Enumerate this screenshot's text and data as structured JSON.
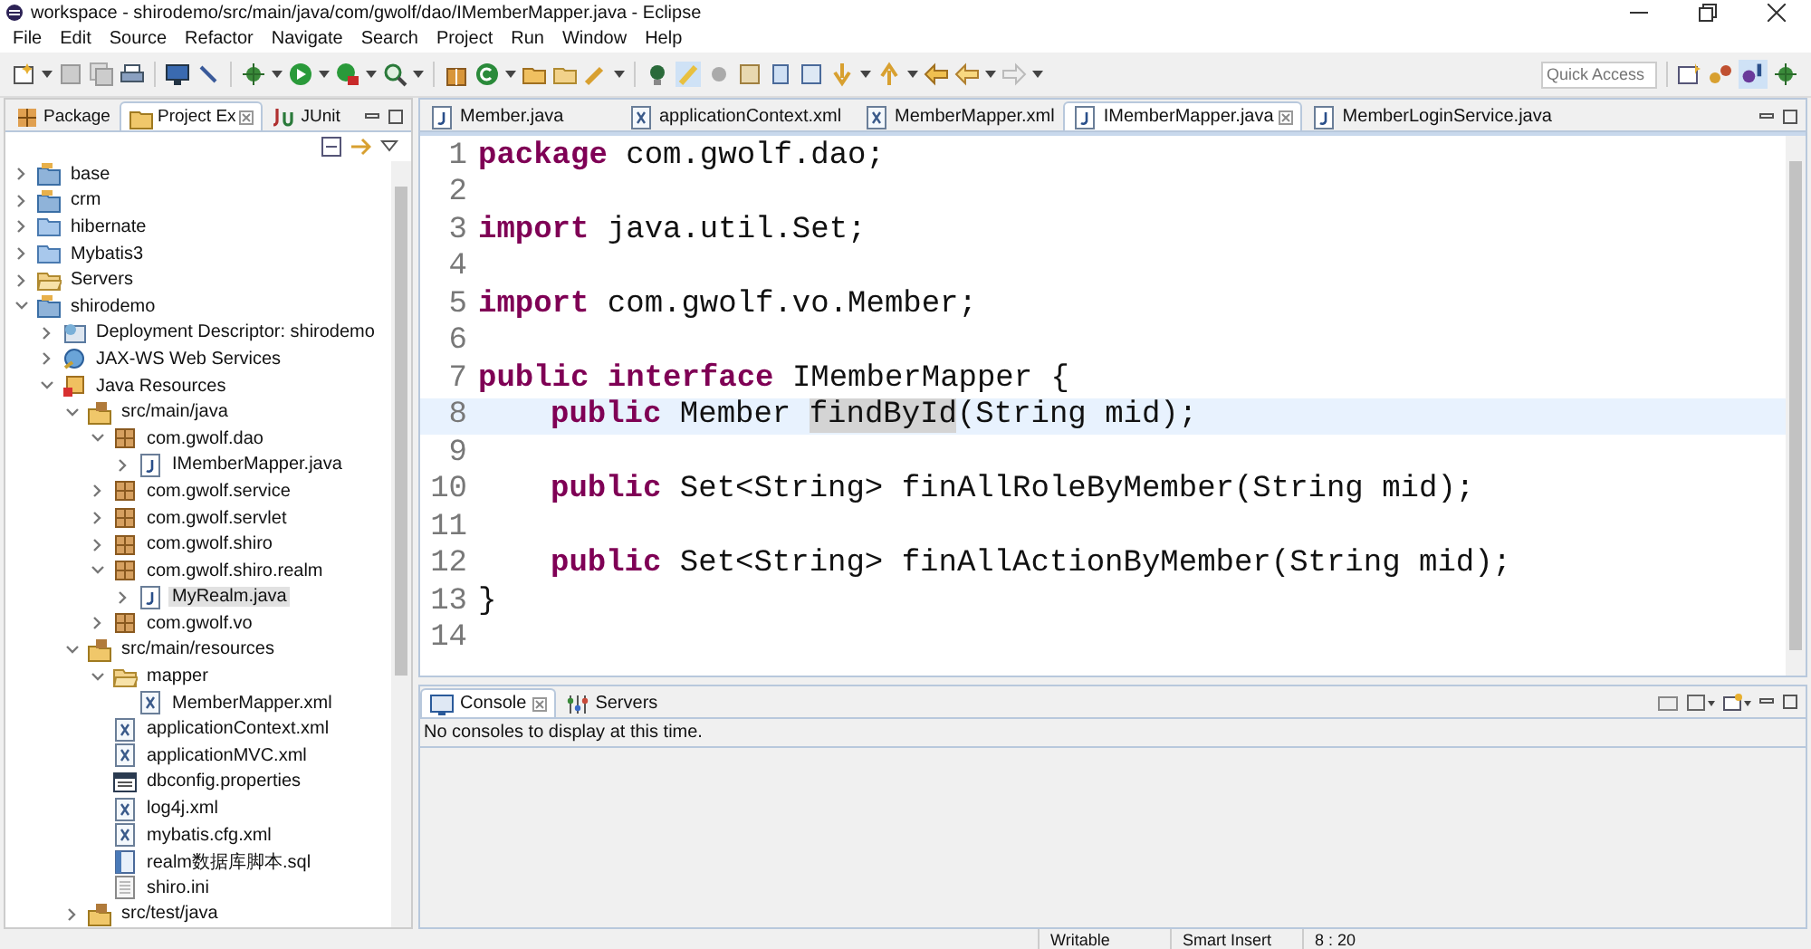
{
  "window": {
    "title": "workspace - shirodemo/src/main/java/com/gwolf/dao/IMemberMapper.java - Eclipse"
  },
  "menu": [
    "File",
    "Edit",
    "Source",
    "Refactor",
    "Navigate",
    "Search",
    "Project",
    "Run",
    "Window",
    "Help"
  ],
  "quick_access": {
    "placeholder": "Quick Access"
  },
  "left_panel": {
    "tabs": [
      {
        "label": "Package",
        "selected": false,
        "kind": "package"
      },
      {
        "label": "Project Ex",
        "selected": true,
        "kind": "project"
      },
      {
        "label": "JUnit",
        "selected": false,
        "kind": "junit"
      }
    ],
    "tree": [
      {
        "label": "base",
        "kind": "project",
        "expanded": false,
        "selected": false
      },
      {
        "label": "crm",
        "kind": "project",
        "expanded": false,
        "selected": false
      },
      {
        "label": "hibernate",
        "kind": "folder",
        "expanded": false,
        "selected": false
      },
      {
        "label": "Mybatis3",
        "kind": "folder",
        "expanded": false,
        "selected": false
      },
      {
        "label": "Servers",
        "kind": "open-folder",
        "expanded": false,
        "selected": false
      },
      {
        "label": "shirodemo",
        "kind": "project",
        "expanded": true,
        "selected": false,
        "children": [
          {
            "label": "Deployment Descriptor: shirodemo",
            "kind": "descriptor",
            "expanded": false,
            "selected": false
          },
          {
            "label": "JAX-WS Web Services",
            "kind": "globe",
            "expanded": false,
            "selected": false
          },
          {
            "label": "Java Resources",
            "kind": "resources",
            "expanded": true,
            "selected": false,
            "children": [
              {
                "label": "src/main/java",
                "kind": "source",
                "expanded": true,
                "selected": false,
                "children": [
                  {
                    "label": "com.gwolf.dao",
                    "kind": "package",
                    "expanded": true,
                    "selected": false,
                    "children": [
                      {
                        "label": "IMemberMapper.java",
                        "kind": "java",
                        "expanded": false,
                        "selected": false
                      }
                    ]
                  },
                  {
                    "label": "com.gwolf.service",
                    "kind": "package",
                    "expanded": false,
                    "selected": false
                  },
                  {
                    "label": "com.gwolf.servlet",
                    "kind": "package",
                    "expanded": false,
                    "selected": false
                  },
                  {
                    "label": "com.gwolf.shiro",
                    "kind": "package",
                    "expanded": false,
                    "selected": false
                  },
                  {
                    "label": "com.gwolf.shiro.realm",
                    "kind": "package",
                    "expanded": true,
                    "selected": false,
                    "children": [
                      {
                        "label": "MyRealm.java",
                        "kind": "java",
                        "expanded": false,
                        "selected": true
                      }
                    ]
                  },
                  {
                    "label": "com.gwolf.vo",
                    "kind": "package",
                    "expanded": false,
                    "selected": false
                  }
                ]
              },
              {
                "label": "src/main/resources",
                "kind": "source",
                "expanded": true,
                "selected": false,
                "children": [
                  {
                    "label": "mapper",
                    "kind": "open-folder",
                    "expanded": true,
                    "selected": false,
                    "children": [
                      {
                        "label": "MemberMapper.xml",
                        "kind": "xml",
                        "selected": false
                      }
                    ]
                  },
                  {
                    "label": "applicationContext.xml",
                    "kind": "xml",
                    "selected": false
                  },
                  {
                    "label": "applicationMVC.xml",
                    "kind": "xml",
                    "selected": false
                  },
                  {
                    "label": "dbconfig.properties",
                    "kind": "properties",
                    "selected": false
                  },
                  {
                    "label": "log4j.xml",
                    "kind": "xml",
                    "selected": false
                  },
                  {
                    "label": "mybatis.cfg.xml",
                    "kind": "xml",
                    "selected": false
                  },
                  {
                    "label": "realm数据库脚本.sql",
                    "kind": "sql",
                    "selected": false
                  },
                  {
                    "label": "shiro.ini",
                    "kind": "text",
                    "selected": false
                  }
                ]
              },
              {
                "label": "src/test/java",
                "kind": "source",
                "expanded": false,
                "selected": false
              }
            ]
          }
        ]
      }
    ]
  },
  "editor": {
    "tabs": [
      {
        "label": "Member.java",
        "kind": "java",
        "selected": false
      },
      {
        "label": "applicationContext.xml",
        "kind": "xml",
        "selected": false
      },
      {
        "label": "MemberMapper.xml",
        "kind": "xml",
        "selected": false
      },
      {
        "label": "IMemberMapper.java",
        "kind": "java",
        "selected": true
      },
      {
        "label": "MemberLoginService.java",
        "kind": "java",
        "selected": false
      }
    ],
    "lines": [
      {
        "number": "1",
        "current": false,
        "tokens": [
          {
            "text": "package",
            "kind": "keyword"
          },
          {
            "text": " com.gwolf.dao;",
            "kind": "plain"
          }
        ]
      },
      {
        "number": "2",
        "current": false
      },
      {
        "number": "3",
        "current": false,
        "tokens": [
          {
            "text": "import",
            "kind": "keyword"
          },
          {
            "text": " java.util.Set;",
            "kind": "plain"
          }
        ]
      },
      {
        "number": "4",
        "current": false
      },
      {
        "number": "5",
        "current": false,
        "tokens": [
          {
            "text": "import",
            "kind": "keyword"
          },
          {
            "text": " com.gwolf.vo.Member;",
            "kind": "plain"
          }
        ]
      },
      {
        "number": "6",
        "current": false
      },
      {
        "number": "7",
        "current": false,
        "tokens": [
          {
            "text": "public",
            "kind": "keyword"
          },
          {
            "text": " interface",
            "kind": "keyword"
          },
          {
            "text": " IMemberMapper {",
            "kind": "plain"
          }
        ]
      },
      {
        "number": "8",
        "current": true,
        "indented": true,
        "tokens": [
          {
            "text": "public",
            "kind": "keyword"
          },
          {
            "text": " Member ",
            "kind": "plain"
          },
          {
            "text": "findById",
            "kind": "occurrence"
          },
          {
            "text": "(String mid);",
            "kind": "plain"
          }
        ]
      },
      {
        "number": "9",
        "current": false
      },
      {
        "number": "10",
        "current": false,
        "indented": true,
        "tokens": [
          {
            "text": "public",
            "kind": "keyword"
          },
          {
            "text": " Set<String> finAllRoleByMember(String mid);",
            "kind": "plain"
          }
        ]
      },
      {
        "number": "11",
        "current": false
      },
      {
        "number": "12",
        "current": false,
        "indented": true,
        "tokens": [
          {
            "text": "public",
            "kind": "keyword"
          },
          {
            "text": " Set<String> finAllActionByMember(String mid);",
            "kind": "plain"
          }
        ]
      },
      {
        "number": "13",
        "current": false,
        "tokens": [
          {
            "text": "}",
            "kind": "plain"
          }
        ]
      },
      {
        "number": "14",
        "current": false
      }
    ]
  },
  "console": {
    "tabs": [
      {
        "label": "Console",
        "kind": "console",
        "selected": true
      },
      {
        "label": "Servers",
        "kind": "servers",
        "selected": false
      }
    ],
    "message": "No consoles to display at this time."
  },
  "status_bar": [
    "Writable",
    "Smart Insert",
    "8 : 20"
  ]
}
